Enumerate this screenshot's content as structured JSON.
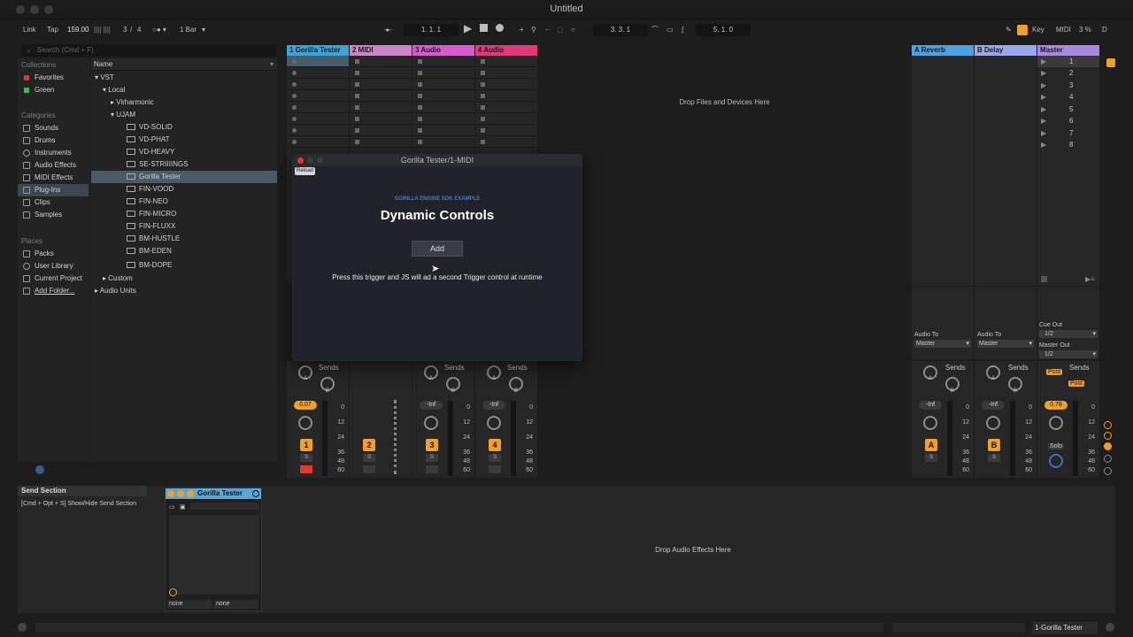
{
  "window": {
    "title": "Untitled"
  },
  "control_bar": {
    "link": "Link",
    "tap": "Tap",
    "tempo": "159.00",
    "sig_num": "3",
    "sig_sep": "/",
    "sig_den": "4",
    "quant": "1 Bar",
    "position": "1.   1.   1",
    "loop_start": "3.   3.   1",
    "loop_len": "5.   1.   0",
    "key": "Key",
    "midi": "MIDI",
    "cpu": "3 %",
    "d": "D"
  },
  "browser": {
    "search_placeholder": "Search (Cmd + F)",
    "collections_header": "Collections",
    "collections": [
      {
        "label": "Favorites",
        "color": "#e0392f"
      },
      {
        "label": "Green",
        "color": "#3bc04a"
      }
    ],
    "categories_header": "Categories",
    "categories": [
      "Sounds",
      "Drums",
      "Instruments",
      "Audio Effects",
      "MIDI Effects",
      "Plug-Ins",
      "Clips",
      "Samples"
    ],
    "places_header": "Places",
    "places": [
      "Packs",
      "User Library",
      "Current Project",
      "Add Folder..."
    ],
    "name_header": "Name",
    "tree": {
      "vst": "VST",
      "local": "Local",
      "virharmonic": "Virharmonic",
      "ujam": "UJAM",
      "plugins": [
        "VD-SOLID",
        "VD-PHAT",
        "VD-HEAVY",
        "SE-STRIIIINGS",
        "Gorilla Tester",
        "FIN-VOOD",
        "FIN-NEO",
        "FIN-MICRO",
        "FIN-FLUXX",
        "BM-HUSTLE",
        "BM-EDEN",
        "BM-DOPE"
      ],
      "custom": "Custom",
      "audio_units": "Audio Units"
    }
  },
  "tracks": [
    {
      "name": "1 Gorilla Tester",
      "color": "#3aa3d9",
      "number": "1",
      "volume": "0.07"
    },
    {
      "name": "2 MIDI",
      "color": "#c985c8",
      "number": "2",
      "volume": ""
    },
    {
      "name": "3 Audio",
      "color": "#d95ad0",
      "number": "3",
      "volume": "-Inf"
    },
    {
      "name": "4 Audio",
      "color": "#e0397a",
      "number": "4",
      "volume": "-Inf"
    }
  ],
  "returns": [
    {
      "name": "A Reverb",
      "color": "#4ea0e0",
      "number": "A",
      "volume": "-Inf"
    },
    {
      "name": "B Delay",
      "color": "#9aa8e8",
      "number": "B",
      "volume": "-Inf"
    }
  ],
  "master": {
    "name": "Master",
    "color": "#a78ae0",
    "volume": "0.78",
    "scenes": [
      "1",
      "2",
      "3",
      "4",
      "5",
      "6",
      "7",
      "8"
    ],
    "cue_out_label": "Cue Out",
    "cue_out": "1/2",
    "master_out_label": "Master Out",
    "master_out": "1/2",
    "post": "Post",
    "solo": "Solo"
  },
  "session": {
    "drop_files": "Drop Files and Devices Here",
    "sends": "Sends",
    "send_a": "A",
    "send_b": "B",
    "solo_s": "S",
    "audio_to_label": "Audio To",
    "audio_to": "Master",
    "meter_scale": [
      "0",
      "12",
      "24",
      "36",
      "48",
      "60"
    ]
  },
  "plugin_window": {
    "title": "Gorilla Tester/1-MIDI",
    "reload": "Reload",
    "subtitle": "GORILLA ENGINE SDK EXAMPLE",
    "heading": "Dynamic Controls",
    "add_button": "Add",
    "description": "Press this trigger and JS will ad a second Trigger control at runtime"
  },
  "detail": {
    "send_section_title": "Send Section",
    "send_section_help": "[Cmd + Opt + S] Show/Hide Send Section",
    "device_name": "Gorilla Tester",
    "device_none_1": "none",
    "device_none_2": "none",
    "drop_audio": "Drop Audio Effects Here"
  },
  "status": {
    "selected_track": "1-Gorilla Tester"
  }
}
